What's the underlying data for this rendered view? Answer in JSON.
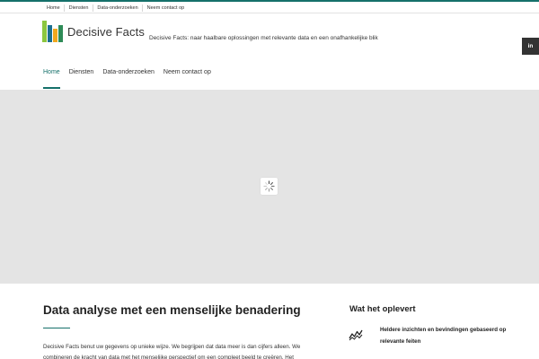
{
  "top_nav": {
    "items": [
      "Home",
      "Diensten",
      "Data-onderzoeken",
      "Neem contact op"
    ]
  },
  "logo": {
    "text": "Decisive Facts",
    "bar_colors": [
      "#8cc63f",
      "#1b6f8f",
      "#f1a81e",
      "#2e8b57"
    ]
  },
  "tagline": "Decisive Facts: naar haalbare oplossingen met relevante data en een onafhankelijke blik",
  "social": {
    "linkedin_label": "in"
  },
  "main_nav": {
    "items": [
      "Home",
      "Diensten",
      "Data-onderzoeken",
      "Neem contact op"
    ],
    "active": "Home"
  },
  "colors": {
    "accent": "#15706a",
    "hero_bg": "#e4e4e4",
    "social_bg": "#333333"
  },
  "content": {
    "heading": "Data analyse met een menselijke benadering",
    "intro": "Decisive Facts benut uw gegevens op unieke wijze. We begrijpen dat data meer is dan cijfers alleen. We combineren de kracht van data met het menselijke perspectief om een compleet beeld te creëren. Het"
  },
  "sidebar": {
    "heading": "Wat het oplevert",
    "benefit_icon": "trend-line-icon",
    "benefit": "Heldere inzichten en bevindingen gebaseerd op relevante feiten"
  }
}
